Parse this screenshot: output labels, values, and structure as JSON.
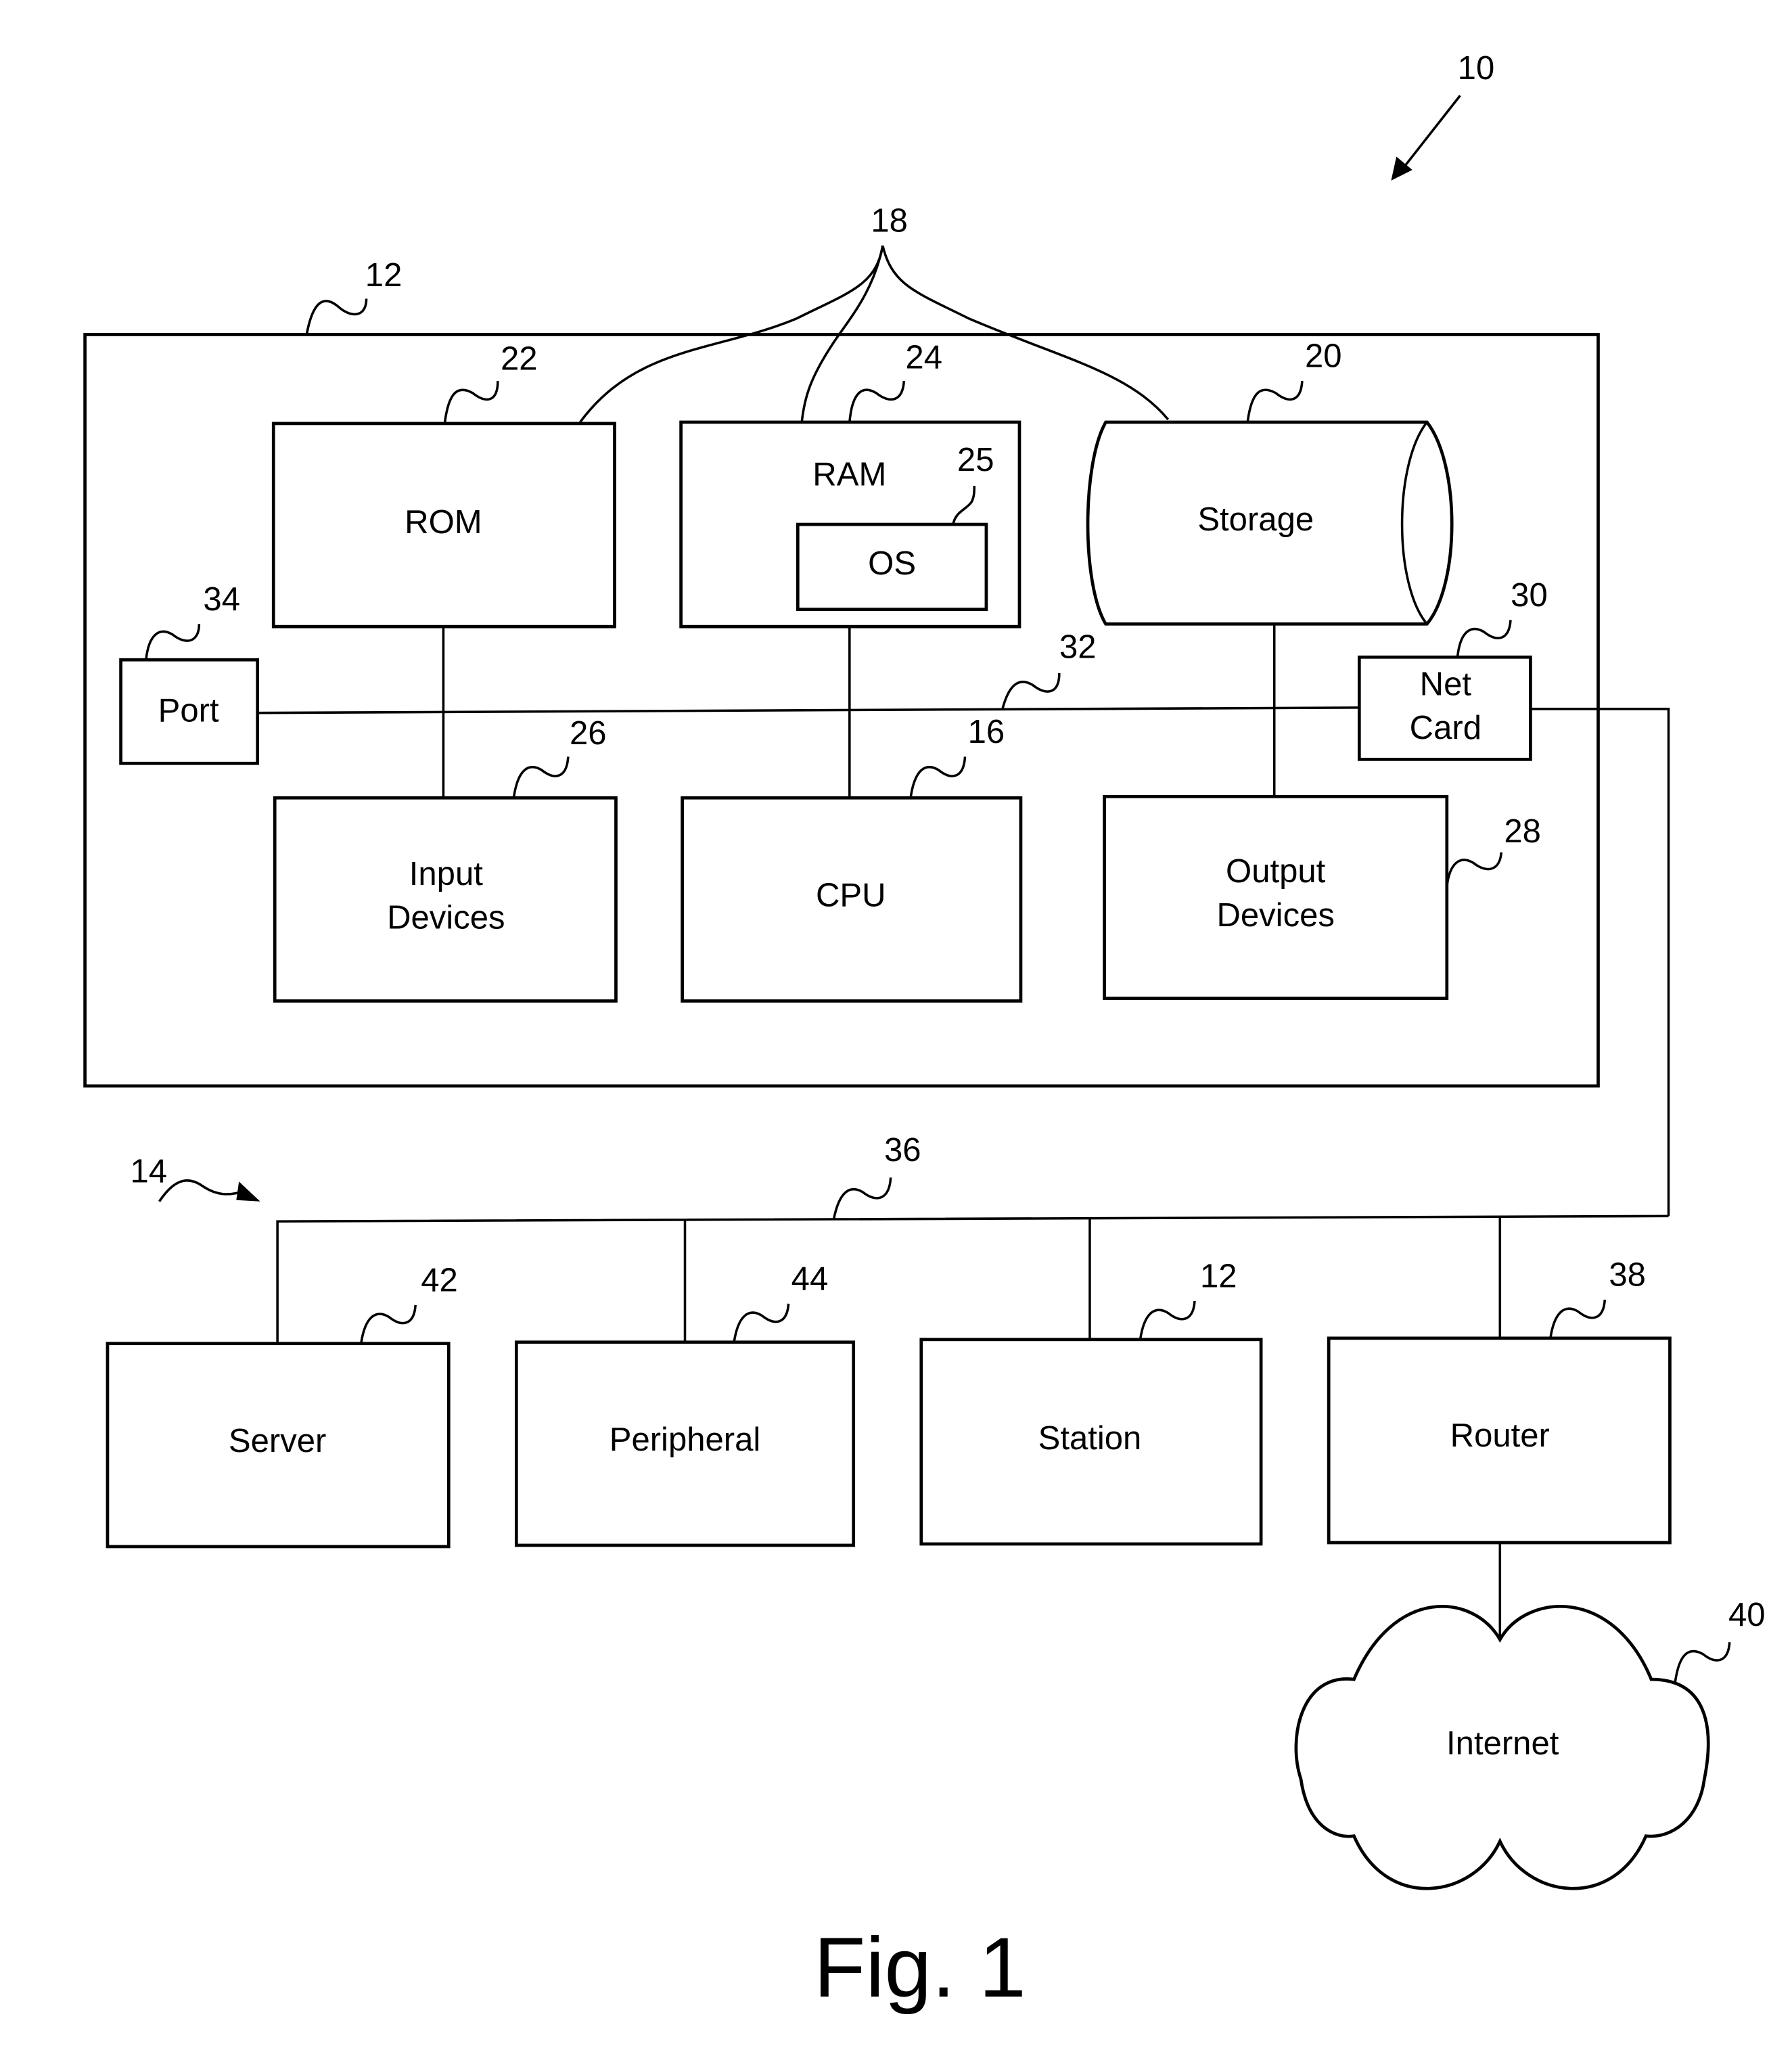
{
  "figure": {
    "caption": "Fig. 1",
    "reference": "10"
  },
  "computer": {
    "reference": "12",
    "bus_reference": "18",
    "internal_bus_reference": "32",
    "components": {
      "rom": {
        "label": "ROM",
        "ref": "22"
      },
      "ram": {
        "label": "RAM",
        "ref": "24"
      },
      "os": {
        "label": "OS",
        "ref": "25"
      },
      "storage": {
        "label": "Storage",
        "ref": "20"
      },
      "port": {
        "label": "Port",
        "ref": "34"
      },
      "net_card": {
        "label_line1": "Net",
        "label_line2": "Card",
        "ref": "30"
      },
      "input_devices": {
        "label_line1": "Input",
        "label_line2": "Devices",
        "ref": "26"
      },
      "cpu": {
        "label": "CPU",
        "ref": "16"
      },
      "output_devices": {
        "label_line1": "Output",
        "label_line2": "Devices",
        "ref": "28"
      }
    }
  },
  "network": {
    "reference": "14",
    "bus_reference": "36",
    "nodes": {
      "server": {
        "label": "Server",
        "ref": "42"
      },
      "peripheral": {
        "label": "Peripheral",
        "ref": "44"
      },
      "station": {
        "label": "Station",
        "ref": "12"
      },
      "router": {
        "label": "Router",
        "ref": "38"
      },
      "internet": {
        "label": "Internet",
        "ref": "40"
      }
    }
  }
}
